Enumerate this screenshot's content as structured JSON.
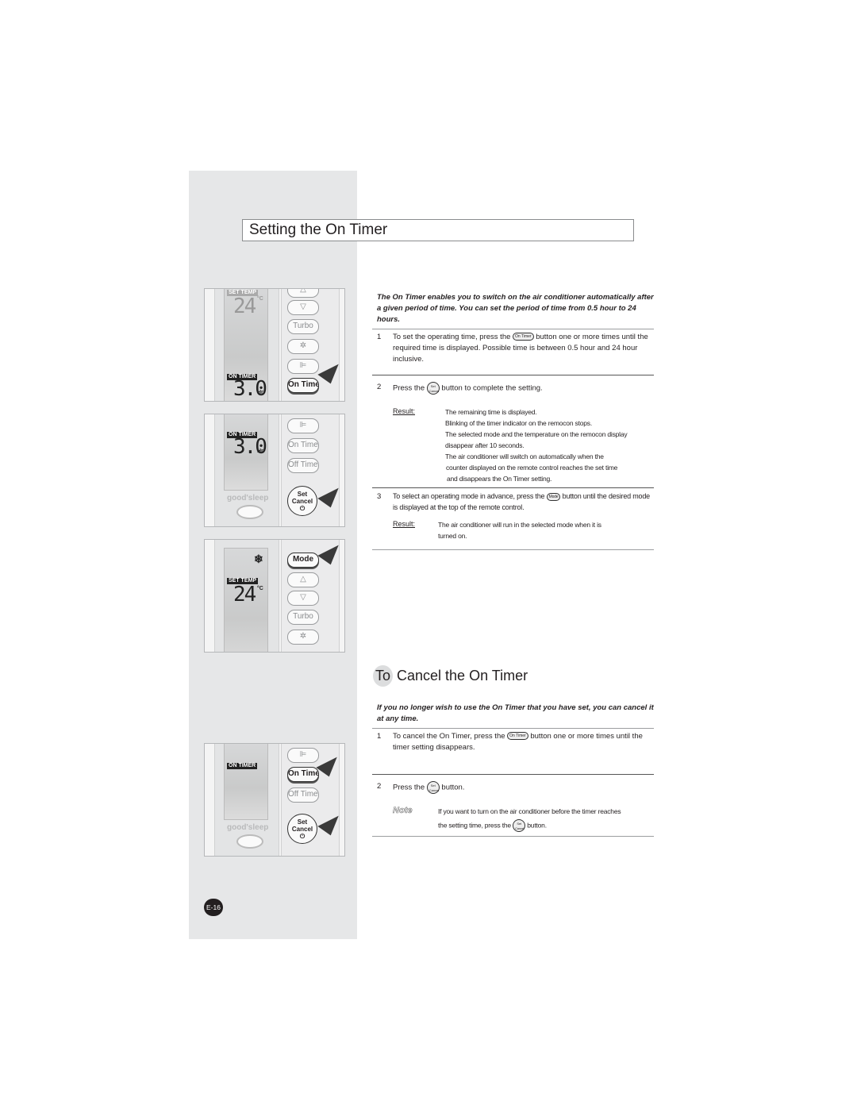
{
  "title": "Setting the On Timer",
  "intro": "The On Timer enables you to switch on the air conditioner automatically after a given period of time. You can set the period of time from 0.5 hour to 24 hours.",
  "steps": [
    {
      "num": "1",
      "pre": "To set the operating time, press the",
      "button": "On Timer",
      "post": "button one or more times until the required time is displayed. Possible time is between 0.5 hour and 24 hour inclusive."
    },
    {
      "num": "2",
      "pre": "Press the",
      "button": "Set Cancel",
      "post": "button to complete the setting.",
      "result_label": "Result:",
      "result_lines": [
        "The remaining time is displayed.",
        "Blinking of the timer indicator on the remocon stops.",
        "The selected mode and the temperature on the remocon display",
        "disappear after 10 seconds.",
        "The air conditioner will switch on automatically when the",
        "counter displayed on the remote control reaches the set time",
        "and disappears the On Timer setting."
      ]
    },
    {
      "num": "3",
      "pre": "To select an operating mode in advance, press the",
      "button": "Mode",
      "post": "button until the desired mode is displayed at the top of the remote control.",
      "result_label": "Result:",
      "result_lines": [
        "The air conditioner will run in the selected mode when it is",
        "turned on."
      ]
    }
  ],
  "cancel": {
    "title": "To Cancel the On Timer",
    "title_first": "To",
    "title_rest": " Cancel the On Timer",
    "intro": "If you no longer wish to use the On Timer that you have set, you can cancel it at any time.",
    "steps": [
      {
        "num": "1",
        "pre": "To cancel the On Timer, press the",
        "button": "On Timer",
        "post": "button one or more times until the timer setting disappears."
      },
      {
        "num": "2",
        "pre": "Press the",
        "button": "Set Cancel",
        "post": "button.",
        "note_label": "Note",
        "note_line1": "If you want to turn on the air conditioner before the timer reaches",
        "note_pre": "the setting time, press the",
        "note_button": "Set Cancel",
        "note_post": "button."
      }
    ]
  },
  "remote": {
    "set_temp": "SET TEMP",
    "on_timer_tag": "ON TIMER",
    "temp": "24",
    "unit_c": "°C",
    "time": "3.0",
    "unit_hr": "Hr.",
    "turbo": "Turbo",
    "on_timer": "On Timer",
    "off_timer": "Off Timer",
    "set": "Set",
    "cancel": "Cancel",
    "mode": "Mode",
    "brand": "good'sleep",
    "up": "△",
    "down": "▽",
    "fan": "✲",
    "swing": "⊫",
    "snow": "❄",
    "power": "⏻"
  },
  "page_number": "E-16",
  "colors": {
    "sidebar": "#e6e7e8",
    "text": "#231f20",
    "badge": "#231f20"
  }
}
